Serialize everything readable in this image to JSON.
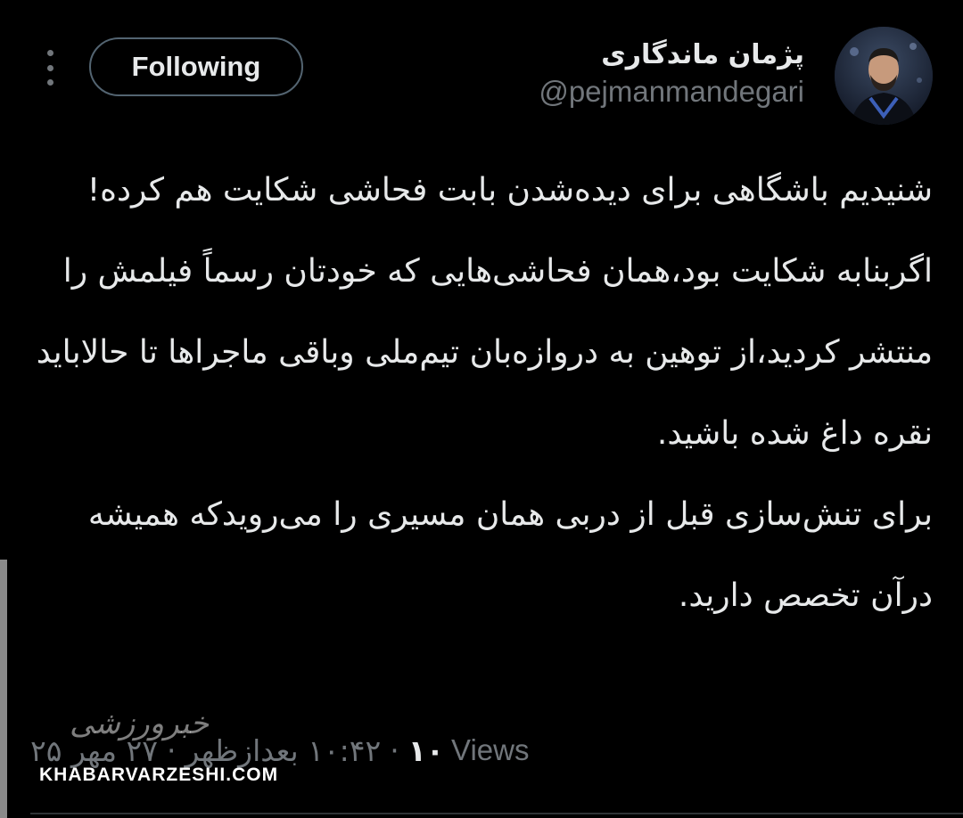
{
  "header": {
    "follow_label": "Following",
    "display_name": "پژمان ماندگاری",
    "handle": "@pejmanmandegari"
  },
  "tweet": {
    "text": "شنیدیم باشگاهی برای دیده‌شدن بابت فحاشی شکایت هم کرده!\nاگربنابه شکایت بود،همان فحاشی‌هایی که خودتان رسماً فیلمش را منتشر کردید،از توهین به دروازه‌بان تیم‌ملی وباقی ماجراها تا حالاباید نقره داغ شده باشید.\nبرای تنش‌سازی قبل از دربی همان مسیری را می‌رویدکه همیشه درآن تخصص دارید."
  },
  "meta": {
    "time": "۱۰:۴۲ بعدازظهر",
    "date": "۲۷ مهر ۲۵",
    "views_count": "۱۰",
    "views_label": "Views"
  },
  "watermark": {
    "logo": "خبرورزشی",
    "site": "KHABARVARZESHI.COM"
  },
  "icons": {
    "menu": "more-vertical-icon",
    "avatar": "avatar-photo"
  },
  "colors": {
    "background": "#000000",
    "text": "#e7e9ea",
    "secondary": "#71767b",
    "button_border": "#536471"
  }
}
